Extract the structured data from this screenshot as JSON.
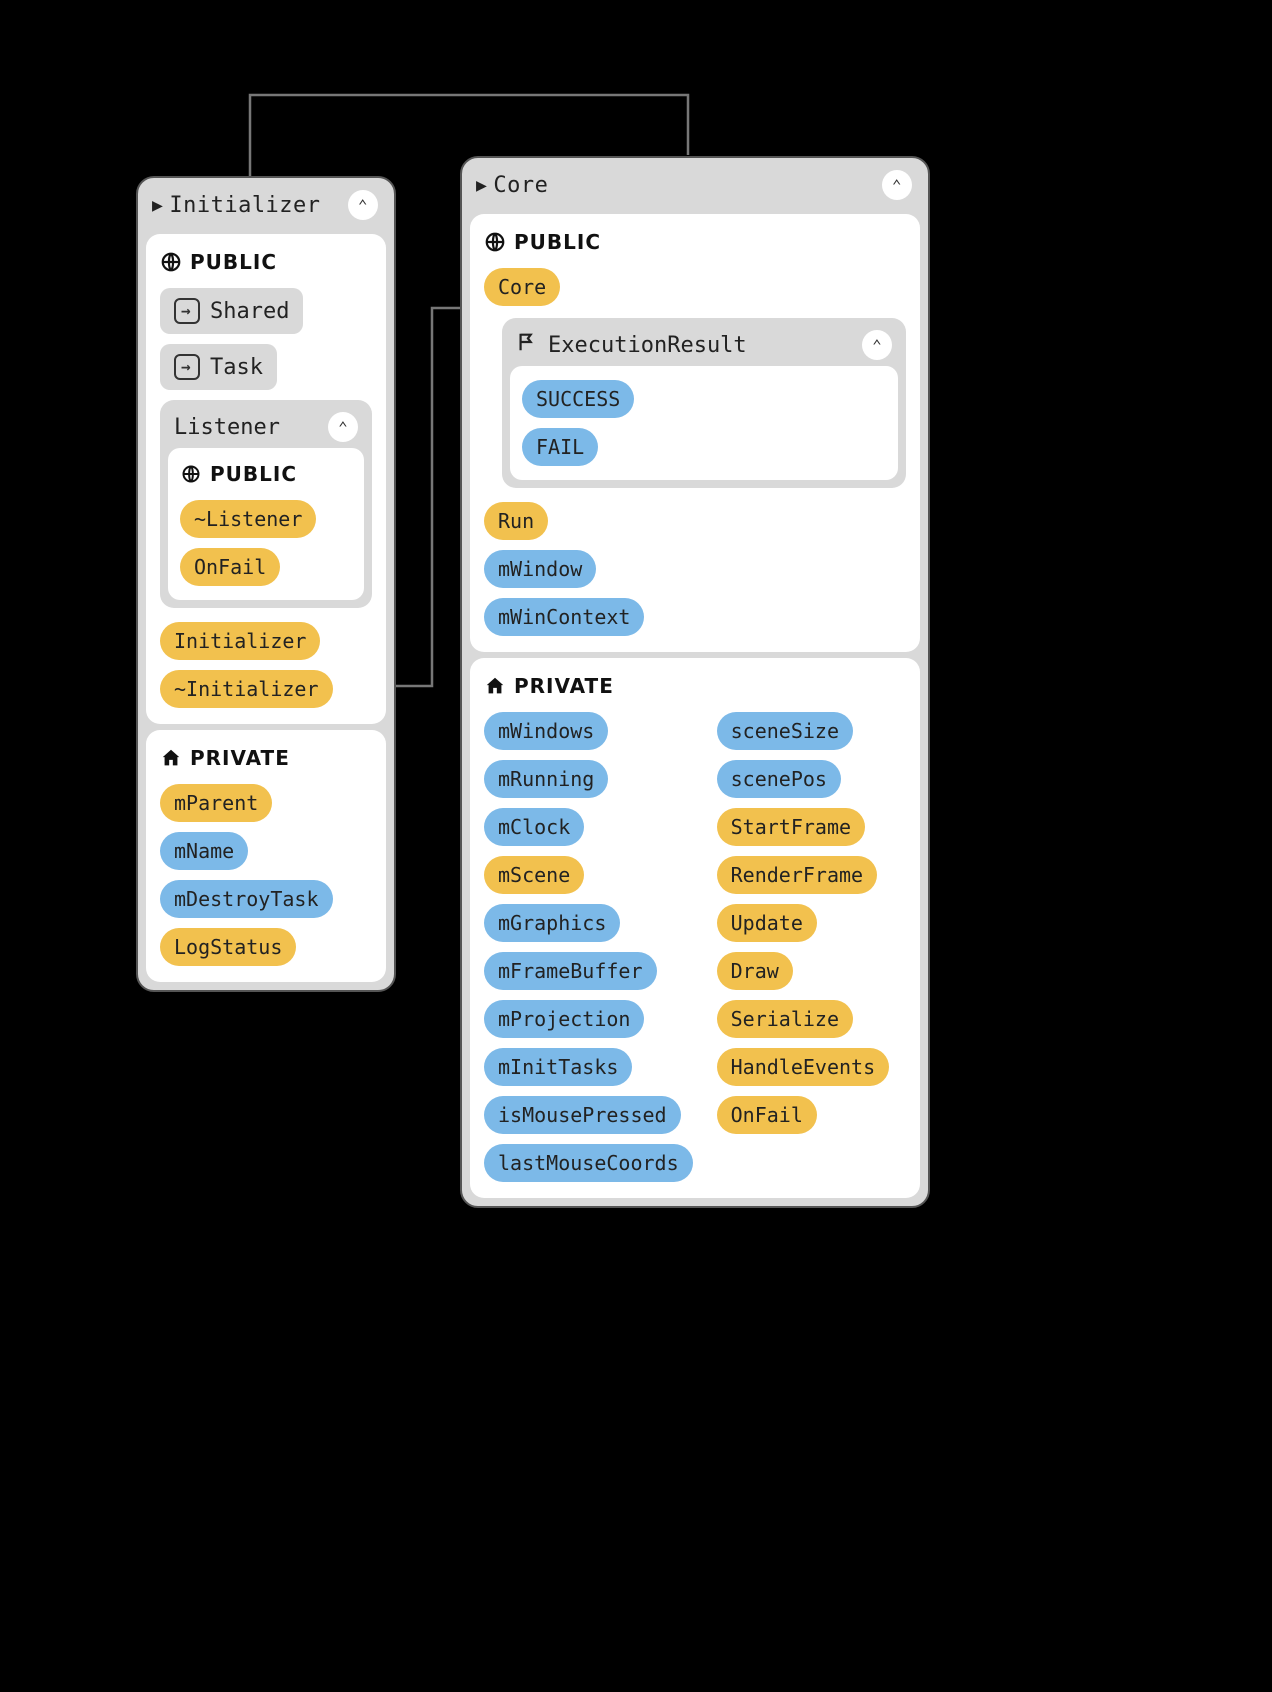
{
  "initializer": {
    "title": "Initializer",
    "public_label": "PUBLIC",
    "private_label": "PRIVATE",
    "shared_label": "Shared",
    "task_label": "Task",
    "listener": {
      "title": "Listener",
      "public_label": "PUBLIC",
      "members": [
        {
          "label": "~Listener",
          "color": "yellow"
        },
        {
          "label": "OnFail",
          "color": "yellow"
        }
      ]
    },
    "public_members": [
      {
        "label": "Initializer",
        "color": "yellow"
      },
      {
        "label": "~Initializer",
        "color": "yellow"
      }
    ],
    "private_members": [
      {
        "label": "mParent",
        "color": "yellow"
      },
      {
        "label": "mName",
        "color": "blue"
      },
      {
        "label": "mDestroyTask",
        "color": "blue"
      },
      {
        "label": "LogStatus",
        "color": "yellow"
      }
    ]
  },
  "core": {
    "title": "Core",
    "public_label": "PUBLIC",
    "private_label": "PRIVATE",
    "core_pill": "Core",
    "execution_result": {
      "title": "ExecutionResult",
      "members": [
        {
          "label": "SUCCESS",
          "color": "blue"
        },
        {
          "label": "FAIL",
          "color": "blue"
        }
      ]
    },
    "public_members": [
      {
        "label": "Run",
        "color": "yellow"
      },
      {
        "label": "mWindow",
        "color": "blue"
      },
      {
        "label": "mWinContext",
        "color": "blue"
      }
    ],
    "private_left": [
      {
        "label": "mWindows",
        "color": "blue"
      },
      {
        "label": "mRunning",
        "color": "blue"
      },
      {
        "label": "mClock",
        "color": "blue"
      },
      {
        "label": "mScene",
        "color": "yellow"
      },
      {
        "label": "mGraphics",
        "color": "blue"
      },
      {
        "label": "mFrameBuffer",
        "color": "blue"
      },
      {
        "label": "mProjection",
        "color": "blue"
      },
      {
        "label": "mInitTasks",
        "color": "blue"
      },
      {
        "label": "isMousePressed",
        "color": "blue"
      },
      {
        "label": "lastMouseCoords",
        "color": "blue"
      }
    ],
    "private_right": [
      {
        "label": "sceneSize",
        "color": "blue"
      },
      {
        "label": "scenePos",
        "color": "blue"
      },
      {
        "label": "StartFrame",
        "color": "yellow"
      },
      {
        "label": "RenderFrame",
        "color": "yellow"
      },
      {
        "label": "Update",
        "color": "yellow"
      },
      {
        "label": "Draw",
        "color": "yellow"
      },
      {
        "label": "Serialize",
        "color": "yellow"
      },
      {
        "label": "HandleEvents",
        "color": "yellow"
      },
      {
        "label": "OnFail",
        "color": "yellow"
      }
    ]
  }
}
